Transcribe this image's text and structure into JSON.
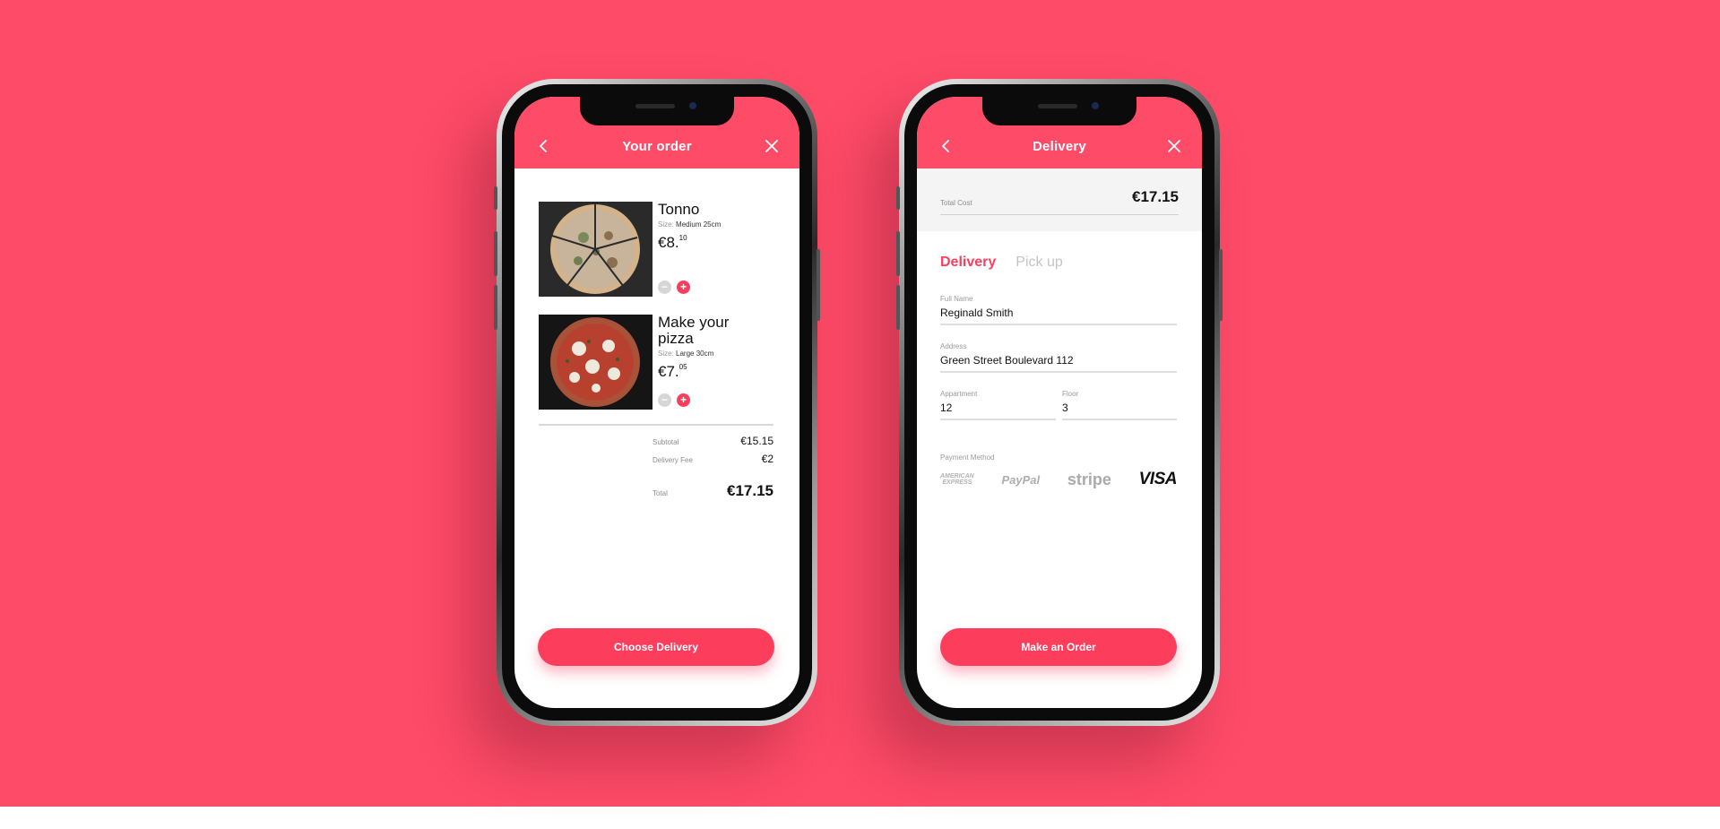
{
  "colors": {
    "accent": "#fd4b68",
    "button": "#fd3d5c"
  },
  "order_screen": {
    "header": {
      "title": "Your order",
      "back_icon": "chevron-left-icon",
      "close_icon": "close-icon"
    },
    "items": [
      {
        "name": "Tonno",
        "size_label": "Size:",
        "size_value": "Medium 25cm",
        "price_main": "€8.",
        "price_cents": "10"
      },
      {
        "name": "Make your pizza",
        "size_label": "Size:",
        "size_value": "Large 30cm",
        "price_main": "€7.",
        "price_cents": "05"
      }
    ],
    "stepper": {
      "minus": "−",
      "plus": "+"
    },
    "summary": {
      "subtotal_label": "Subtotal",
      "subtotal_value": "€15.15",
      "delivery_label": "Delivery Fee",
      "delivery_value": "€2",
      "total_label": "Total",
      "total_value": "€17.15"
    },
    "cta_label": "Choose Delivery"
  },
  "delivery_screen": {
    "header": {
      "title": "Delivery",
      "back_icon": "chevron-left-icon",
      "close_icon": "close-icon"
    },
    "total_cost_label": "Total Cost",
    "total_cost_value": "€17.15",
    "tabs": {
      "active": "Delivery",
      "inactive": "Pick up"
    },
    "fields": {
      "full_name_label": "Full Name",
      "full_name_value": "Reginald Smith",
      "address_label": "Address",
      "address_value": "Green Street Boulevard 112",
      "apartment_label": "Appartment",
      "apartment_value": "12",
      "floor_label": "Floor",
      "floor_value": "3"
    },
    "payment_label": "Payment Method",
    "payment_methods": {
      "amex_line1": "AMERICAN",
      "amex_line2": "EXPRESS",
      "paypal": "PayPal",
      "stripe": "stripe",
      "visa": "VISA"
    },
    "cta_label": "Make an Order"
  }
}
